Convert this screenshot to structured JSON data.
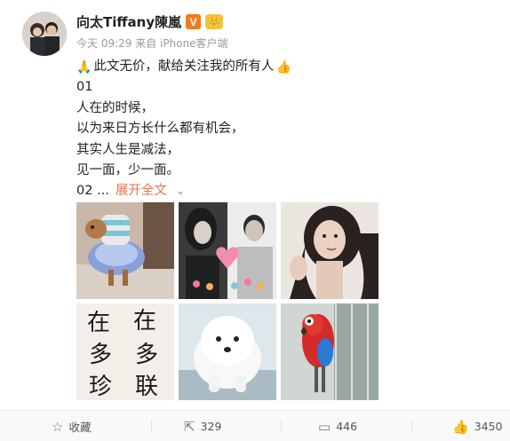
{
  "user": {
    "name": "向太Tiffany陳嵐",
    "vip_badge": "V",
    "crown": "👑",
    "timestamp": "今天 09:29",
    "source": "来自 iPhone客户端"
  },
  "post": {
    "line1": "此文无价，献给关注我的所有人",
    "line2": "01",
    "line3": "人在的时候，",
    "line4": "以为来日方长什么都有机会，",
    "line5": "其实人生是减法，",
    "line6": "见一面，少一面。",
    "line7_num": "02 ...",
    "expand_label": "展开全文",
    "chevron": "⌄",
    "pray_emoji": "🙏",
    "thumb_emoji": "👍"
  },
  "images": [
    {
      "label": "dog-in-costume"
    },
    {
      "label": "couple-photo-hearts"
    },
    {
      "label": "woman-portrait"
    },
    {
      "label": "calligraphy"
    },
    {
      "label": "white-puppy"
    },
    {
      "label": "parrot"
    }
  ],
  "calligraphy_text": [
    "在",
    "在",
    "多",
    "多",
    "珍",
    "联"
  ],
  "actions": {
    "favorite_label": "收藏",
    "forward_count": "329",
    "comment_count": "446",
    "like_count": "3450"
  },
  "colors": {
    "accent": "#eb7350",
    "vip_orange": "#ef7d1c"
  }
}
